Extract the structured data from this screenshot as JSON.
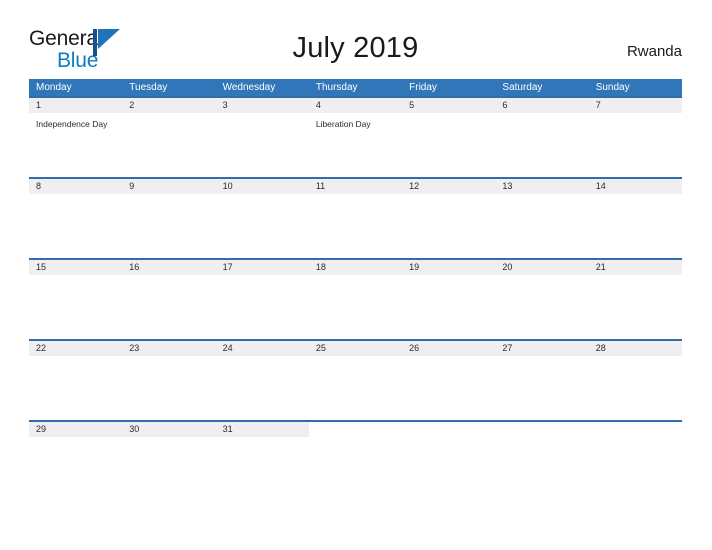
{
  "brand": {
    "name_part1": "General",
    "name_part2": "Blue",
    "flag_icon": "flag-icon",
    "accent_color": "#0f7bc4"
  },
  "header": {
    "title": "July 2019",
    "region": "Rwanda"
  },
  "theme": {
    "header_blue": "#3176b8",
    "row_border_blue": "#2f6eab",
    "date_band_gray": "#efefef",
    "page_background": "#ffffff",
    "text_color": "#2b2b2b"
  },
  "calendar": {
    "month": "July",
    "year": "2019",
    "week_start": "Monday",
    "day_headers": [
      "Monday",
      "Tuesday",
      "Wednesday",
      "Thursday",
      "Friday",
      "Saturday",
      "Sunday"
    ],
    "weeks": [
      [
        {
          "date": "1",
          "event": "Independence Day"
        },
        {
          "date": "2",
          "event": ""
        },
        {
          "date": "3",
          "event": ""
        },
        {
          "date": "4",
          "event": "Liberation Day"
        },
        {
          "date": "5",
          "event": ""
        },
        {
          "date": "6",
          "event": ""
        },
        {
          "date": "7",
          "event": ""
        }
      ],
      [
        {
          "date": "8",
          "event": ""
        },
        {
          "date": "9",
          "event": ""
        },
        {
          "date": "10",
          "event": ""
        },
        {
          "date": "11",
          "event": ""
        },
        {
          "date": "12",
          "event": ""
        },
        {
          "date": "13",
          "event": ""
        },
        {
          "date": "14",
          "event": ""
        }
      ],
      [
        {
          "date": "15",
          "event": ""
        },
        {
          "date": "16",
          "event": ""
        },
        {
          "date": "17",
          "event": ""
        },
        {
          "date": "18",
          "event": ""
        },
        {
          "date": "19",
          "event": ""
        },
        {
          "date": "20",
          "event": ""
        },
        {
          "date": "21",
          "event": ""
        }
      ],
      [
        {
          "date": "22",
          "event": ""
        },
        {
          "date": "23",
          "event": ""
        },
        {
          "date": "24",
          "event": ""
        },
        {
          "date": "25",
          "event": ""
        },
        {
          "date": "26",
          "event": ""
        },
        {
          "date": "27",
          "event": ""
        },
        {
          "date": "28",
          "event": ""
        }
      ],
      [
        {
          "date": "29",
          "event": ""
        },
        {
          "date": "30",
          "event": ""
        },
        {
          "date": "31",
          "event": ""
        },
        {
          "date": "",
          "event": ""
        },
        {
          "date": "",
          "event": ""
        },
        {
          "date": "",
          "event": ""
        },
        {
          "date": "",
          "event": ""
        }
      ]
    ]
  }
}
